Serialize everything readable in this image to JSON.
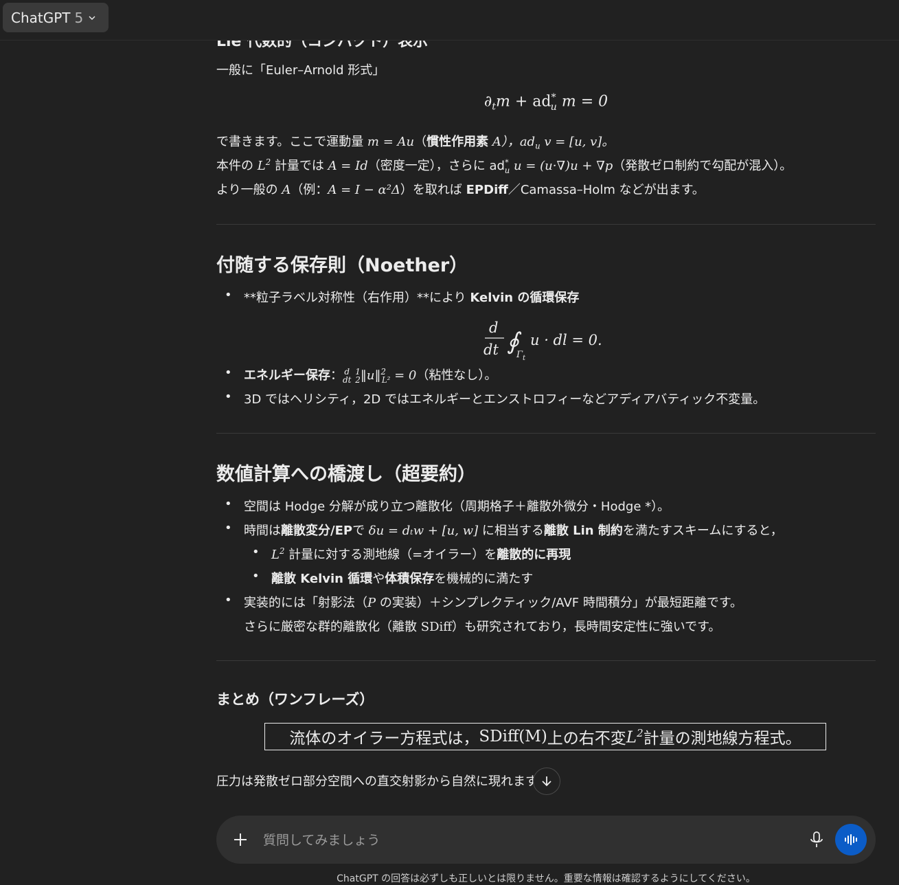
{
  "header": {
    "model_name": "ChatGPT",
    "model_version": "5"
  },
  "section1": {
    "heading": "Lie 代数的（コンパクト）表示",
    "intro": "一般に「Euler–Arnold 形式」",
    "eq": "∂ₜm + ad*ᵤ m = 0",
    "line1_a": "で書きます。ここで運動量 ",
    "line1_m": "m = Au",
    "line1_b": "（",
    "line1_bold": "慣性作用素",
    "line1_c": " A），ad",
    "line1_d": " v = [u, v]。",
    "line2_a": "本件の ",
    "line2_b": " 計量では ",
    "line2_c": "A = Id",
    "line2_d": "（密度一定），さらに ad",
    "line2_e": " u = (u·∇)u + ∇p",
    "line2_f": "（発散ゼロ制約で勾配が混入）。",
    "line3_a": "より一般の ",
    "line3_b": "A",
    "line3_c": "（例：",
    "line3_d": "A = I − α²Δ",
    "line3_e": "）を取れば ",
    "line3_bold": "EPDiff",
    "line3_f": "／Camassa–Holm などが出ます。"
  },
  "section2": {
    "heading": "付随する保存則（Noether）",
    "b1_text": "**粒子ラベル対称性（右作用）**により ",
    "b1_bold": "Kelvin の循環保存",
    "b1_eq": "d/dt ∮ u · dl = 0.",
    "b2_bold": "エネルギー保存",
    "b2_text": "（粘性なし）。",
    "b3_text": "3D ではヘリシティ，2D ではエネルギーとエンストロフィーなどアディアバティック不変量。"
  },
  "section3": {
    "heading": "数値計算への橋渡し（超要約）",
    "b1_text": "空間は Hodge 分解が成り立つ離散化（周期格子＋離散外微分・Hodge *）。",
    "b2_a": "時間は",
    "b2_bold1": "離散変分/EP",
    "b2_b": "で ",
    "b2_eq": "δu = dₜw + [u, w]",
    "b2_c": " に相当する",
    "b2_bold2": "離散 Lin 制約",
    "b2_d": "を満たすスキームにすると，",
    "sb1_a": " 計量に対する測地線（=オイラー）を",
    "sb1_bold": "離散的に再現",
    "sb2_bold1": "離散 Kelvin 循環",
    "sb2_a": "や",
    "sb2_bold2": "体積保存",
    "sb2_b": "を機械的に満たす",
    "b3_a": "実装的には「射影法（",
    "b3_b": "P",
    "b3_c": " の実装）＋シンプレクティック/AVF 時間積分」が最短距離です。",
    "b3_line2_a": "さらに厳密な群的離散化（離散 ",
    "b3_line2_b": "SDiff",
    "b3_line2_c": "）も研究されており，長時間安定性に強いです。"
  },
  "summary": {
    "heading": "まとめ（ワンフレーズ）",
    "boxed_a": "流体のオイラー方程式は，",
    "boxed_b": "SDiff(M)",
    "boxed_c": " 上の右不変 ",
    "boxed_d": " 計量の測地線方程式。",
    "last_line": "圧力は発散ゼロ部分空間への直交射影から自然に現れます。"
  },
  "composer": {
    "placeholder": "質問してみましょう"
  },
  "footer": {
    "disclaimer": "ChatGPT の回答は必ずしも正しいとは限りません。重要な情報は確認するようにしてください。"
  },
  "colors": {
    "background": "#212121",
    "text": "#ececec",
    "voice_button": "#0b5cc7"
  }
}
